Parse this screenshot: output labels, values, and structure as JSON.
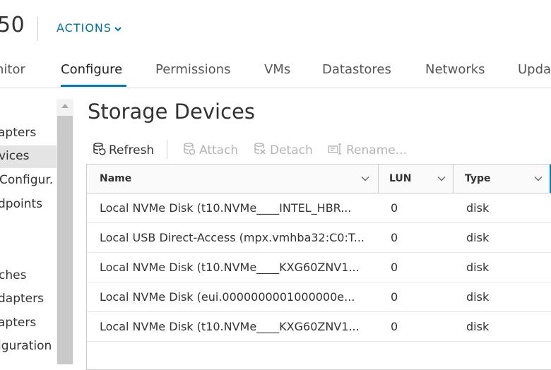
{
  "header": {
    "host_title": "50",
    "actions_label": "ACTIONS"
  },
  "tabs": [
    {
      "label": "nitor",
      "active": false
    },
    {
      "label": "Configure",
      "active": true
    },
    {
      "label": "Permissions",
      "active": false
    },
    {
      "label": "VMs",
      "active": false
    },
    {
      "label": "Datastores",
      "active": false
    },
    {
      "label": "Networks",
      "active": false
    },
    {
      "label": "Upda",
      "active": false
    }
  ],
  "sidebar": {
    "items": [
      {
        "label": "apters",
        "selected": false
      },
      {
        "label": "vices",
        "selected": true
      },
      {
        "label": "Configur.",
        "selected": false
      },
      {
        "label": "dpoints",
        "selected": false
      },
      {
        "label": "ches",
        "selected": false
      },
      {
        "label": "dapters",
        "selected": false
      },
      {
        "label": "apters",
        "selected": false
      },
      {
        "label": "iguration",
        "selected": false
      }
    ]
  },
  "main": {
    "title": "Storage Devices",
    "toolbar": {
      "refresh": "Refresh",
      "attach": "Attach",
      "detach": "Detach",
      "rename": "Rename..."
    },
    "grid": {
      "columns": [
        "Name",
        "LUN",
        "Type"
      ],
      "rows": [
        {
          "name": "Local NVMe Disk (t10.NVMe____INTEL_HBR...",
          "lun": "0",
          "type": "disk"
        },
        {
          "name": "Local USB Direct-Access (mpx.vmhba32:C0:T...",
          "lun": "0",
          "type": "disk"
        },
        {
          "name": "Local NVMe Disk (t10.NVMe____KXG60ZNV1...",
          "lun": "0",
          "type": "disk"
        },
        {
          "name": "Local NVMe Disk (eui.0000000001000000e...",
          "lun": "0",
          "type": "disk"
        },
        {
          "name": "Local NVMe Disk (t10.NVMe____KXG60ZNV1...",
          "lun": "0",
          "type": "disk"
        }
      ]
    }
  },
  "colors": {
    "accent": "#0079b8",
    "link": "#0072a3",
    "disabled": "#b5b5b5",
    "selected_bg": "#e4e4e4"
  },
  "icons": [
    "chevron-down-icon",
    "refresh-icon",
    "attach-icon",
    "detach-icon",
    "rename-icon",
    "scroll-up-icon"
  ]
}
